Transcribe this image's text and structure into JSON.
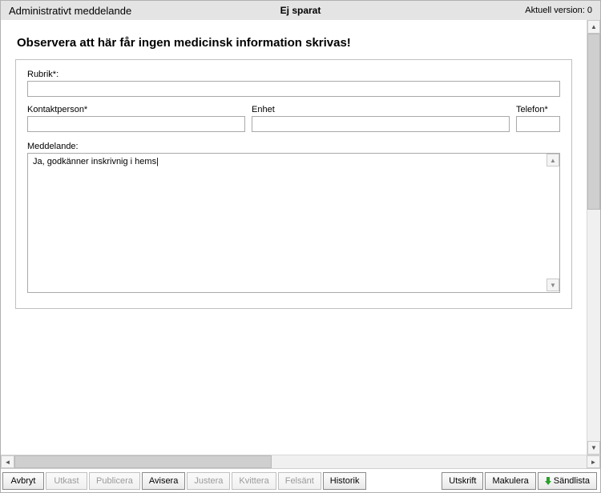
{
  "header": {
    "title": "Administrativt meddelande",
    "status": "Ej sparat",
    "version_label": "Aktuell version: 0"
  },
  "form": {
    "warning": "Observera att här får ingen medicinsk information skrivas!",
    "rubrik_label": "Rubrik*:",
    "rubrik_value": "",
    "kontakt_label": "Kontaktperson*",
    "kontakt_value": "",
    "enhet_label": "Enhet",
    "enhet_value": "",
    "telefon_label": "Telefon*",
    "telefon_value": "",
    "meddelande_label": "Meddelande:",
    "meddelande_value": "Ja, godkänner inskrivnig i hems|"
  },
  "buttons": {
    "avbryt": "Avbryt",
    "utkast": "Utkast",
    "publicera": "Publicera",
    "avisera": "Avisera",
    "justera": "Justera",
    "kvittera": "Kvittera",
    "felsant": "Felsänt",
    "historik": "Historik",
    "utskrift": "Utskrift",
    "makulera": "Makulera",
    "sandlista": "Sändlista"
  }
}
